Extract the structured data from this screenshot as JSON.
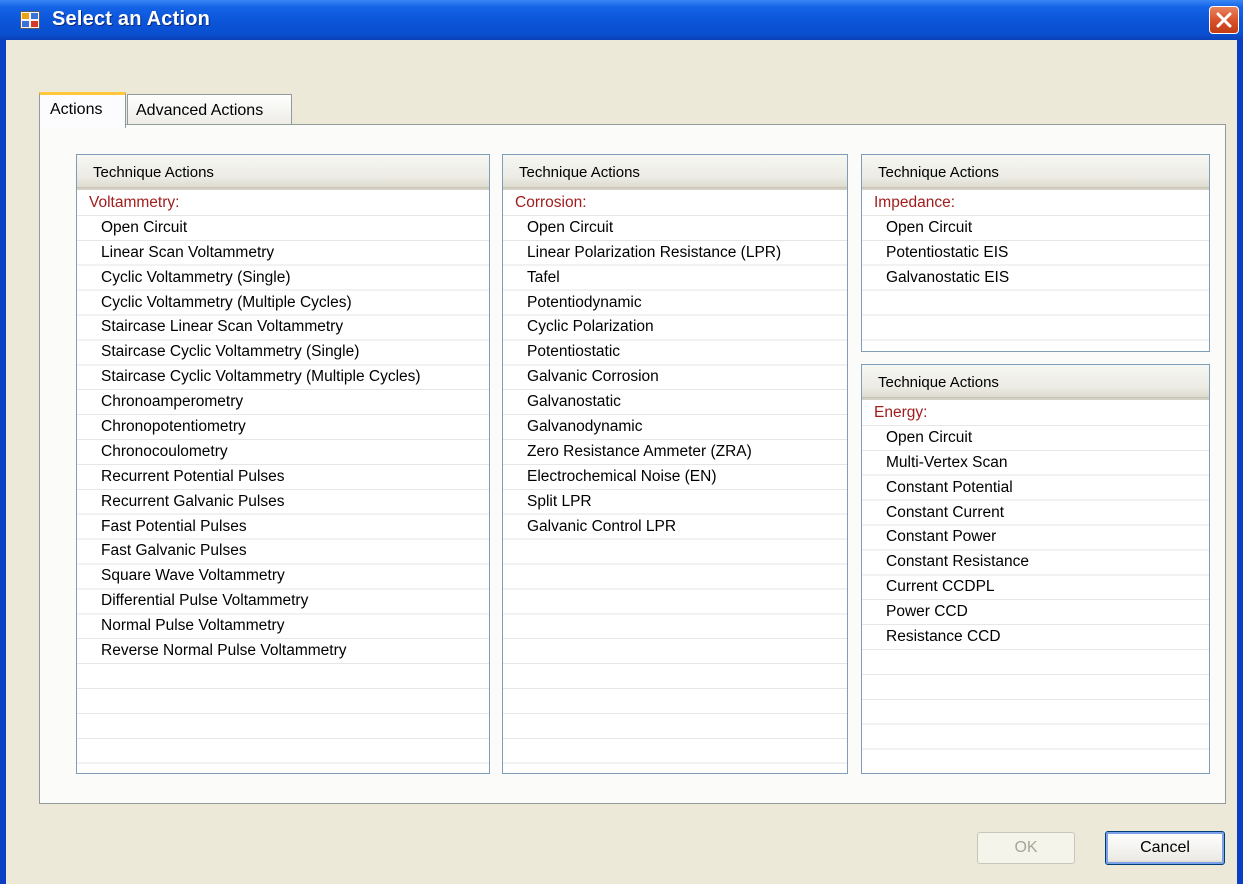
{
  "window": {
    "title": "Select an Action"
  },
  "tabs": [
    {
      "label": "Actions",
      "selected": true
    },
    {
      "label": "Advanced Actions",
      "selected": false
    }
  ],
  "lists": {
    "voltammetry": {
      "header": "Technique Actions",
      "category": "Voltammetry:",
      "items": [
        "Open Circuit",
        "Linear Scan Voltammetry",
        "Cyclic Voltammetry (Single)",
        "Cyclic Voltammetry (Multiple Cycles)",
        "Staircase Linear Scan Voltammetry",
        "Staircase Cyclic Voltammetry (Single)",
        "Staircase Cyclic Voltammetry (Multiple Cycles)",
        "Chronoamperometry",
        "Chronopotentiometry",
        "Chronocoulometry",
        "Recurrent Potential Pulses",
        "Recurrent Galvanic Pulses",
        "Fast Potential Pulses",
        "Fast Galvanic Pulses",
        "Square Wave Voltammetry",
        "Differential Pulse Voltammetry",
        "Normal Pulse Voltammetry",
        "Reverse Normal Pulse Voltammetry"
      ]
    },
    "corrosion": {
      "header": "Technique Actions",
      "category": "Corrosion:",
      "items": [
        "Open Circuit",
        "Linear Polarization Resistance (LPR)",
        "Tafel",
        "Potentiodynamic",
        "Cyclic Polarization",
        "Potentiostatic",
        "Galvanic Corrosion",
        "Galvanostatic",
        "Galvanodynamic",
        "Zero Resistance Ammeter (ZRA)",
        "Electrochemical Noise (EN)",
        "Split LPR",
        "Galvanic Control LPR"
      ]
    },
    "impedance": {
      "header": "Technique Actions",
      "category": "Impedance:",
      "items": [
        "Open Circuit",
        "Potentiostatic EIS",
        "Galvanostatic EIS"
      ]
    },
    "energy": {
      "header": "Technique Actions",
      "category": "Energy:",
      "items": [
        "Open Circuit",
        "Multi-Vertex Scan",
        "Constant Potential",
        "Constant Current",
        "Constant Power",
        "Constant Resistance",
        "Current CCDPL",
        "Power CCD",
        "Resistance CCD"
      ]
    }
  },
  "buttons": {
    "ok": "OK",
    "ok_enabled": false,
    "cancel": "Cancel"
  },
  "colors": {
    "category_text": "#a11d1d",
    "titlebar": "#0a54d8",
    "dialog_bg": "#ece9d8"
  }
}
